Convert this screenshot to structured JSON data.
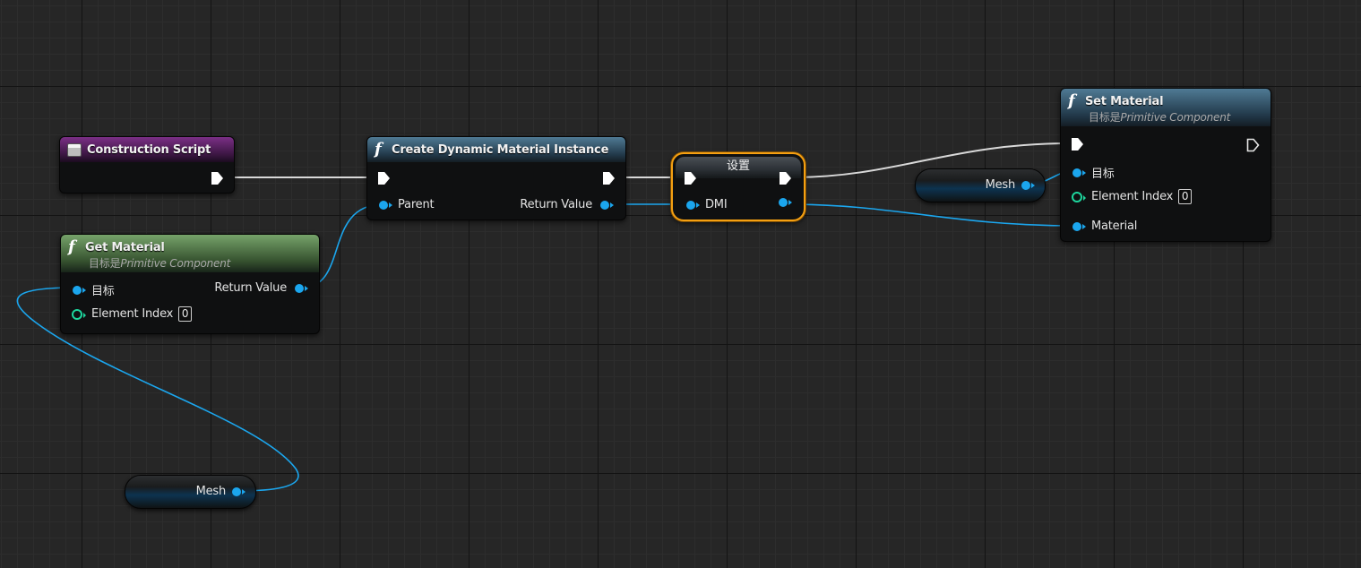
{
  "nodes": {
    "construction_script": {
      "title": "Construction Script"
    },
    "create_dmi": {
      "title": "Create Dynamic Material Instance",
      "input_parent": "Parent",
      "output_return": "Return Value"
    },
    "set_dmi": {
      "title": "设置",
      "pin_label": "DMI"
    },
    "set_material": {
      "title": "Set Material",
      "subtitle_prefix": "目标是",
      "subtitle_target": "Primitive Component",
      "input_target": "目标",
      "input_element_index": "Element Index",
      "element_index_value": "0",
      "input_material": "Material"
    },
    "get_material": {
      "title": "Get Material",
      "subtitle_prefix": "目标是",
      "subtitle_target": "Primitive Component",
      "input_target": "目标",
      "output_return": "Return Value",
      "input_element_index": "Element Index",
      "element_index_value": "0"
    },
    "mesh_var_top": {
      "label": "Mesh"
    },
    "mesh_var_bottom": {
      "label": "Mesh"
    }
  },
  "colors": {
    "background": "#262626",
    "object_pin": "#1ba6ee",
    "integer_pin": "#1dd69d",
    "exec_wire": "#d9d9d9",
    "selection": "#f5a012",
    "event_header": "#7b2f86",
    "function_header": "#4f7a94",
    "pure_function_header": "#76a36a"
  },
  "icons": {
    "event": "event-icon",
    "function": "function-icon",
    "exec_pin": "exec-pin-icon",
    "object_pin": "object-pin-icon",
    "integer_pin": "integer-pin-icon"
  }
}
